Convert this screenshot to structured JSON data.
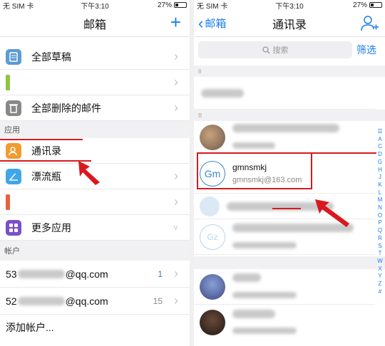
{
  "left": {
    "status": {
      "carrier": "无 SIM 卡",
      "time": "下午3:10",
      "battery": "27%"
    },
    "nav": {
      "title": "邮箱",
      "add": "+"
    },
    "rows": [
      {
        "label": "全部草稿",
        "icon": "drafts-icon",
        "color": "#5b9bd5"
      },
      {
        "label": "",
        "icon": "folder-icon",
        "color": "#8cc63f"
      },
      {
        "label": "全部删除的邮件",
        "icon": "trash-icon",
        "color": "#888888"
      }
    ],
    "section_apps": "应用",
    "apps": [
      {
        "label": "通讯录",
        "icon": "contacts-icon",
        "color": "#f39a2d"
      },
      {
        "label": "漂流瓶",
        "icon": "bottle-icon",
        "color": "#3fa6e8"
      },
      {
        "label": "",
        "icon": "app-icon",
        "color": "#e8603c"
      },
      {
        "label": "更多应用",
        "icon": "more-apps-icon",
        "color": "#7b4fc8"
      }
    ],
    "section_accounts": "帐户",
    "accounts": [
      {
        "prefix": "53",
        "suffix": "@qq.com",
        "count": "1"
      },
      {
        "prefix": "52",
        "suffix": "@qq.com",
        "count": "15"
      }
    ],
    "add_account": "添加帐户..."
  },
  "right": {
    "status": {
      "carrier": "无 SIM 卡",
      "time": "下午3:10",
      "battery": "27%"
    },
    "nav": {
      "back": "邮箱",
      "title": "通讯录"
    },
    "search": {
      "placeholder": "搜索",
      "filter": "筛选"
    },
    "section_letters": [
      "8",
      "B"
    ],
    "alphabet": [
      "☰",
      "A",
      "C",
      "D",
      "G",
      "H",
      "J",
      "K",
      "L",
      "M",
      "N",
      "O",
      "P",
      "Q",
      "R",
      "S",
      "T",
      "W",
      "X",
      "Y",
      "Z",
      "#"
    ],
    "contacts": [
      {
        "name": "",
        "email": "",
        "avatar": "photo"
      },
      {
        "name": "gmnsmkj",
        "email": "gmnsmkj@163.com",
        "initials": "Gm",
        "avatar": "initials"
      },
      {
        "name": "",
        "email": "",
        "avatar": "default"
      },
      {
        "name": "",
        "email": "",
        "avatar": "default",
        "initials": "Gz"
      },
      {
        "name": "",
        "email": "",
        "avatar": "photo"
      },
      {
        "name": "",
        "email": "",
        "avatar": "photo"
      }
    ]
  },
  "colors": {
    "accent": "#1a7cf0",
    "highlight": "#d8191f"
  }
}
